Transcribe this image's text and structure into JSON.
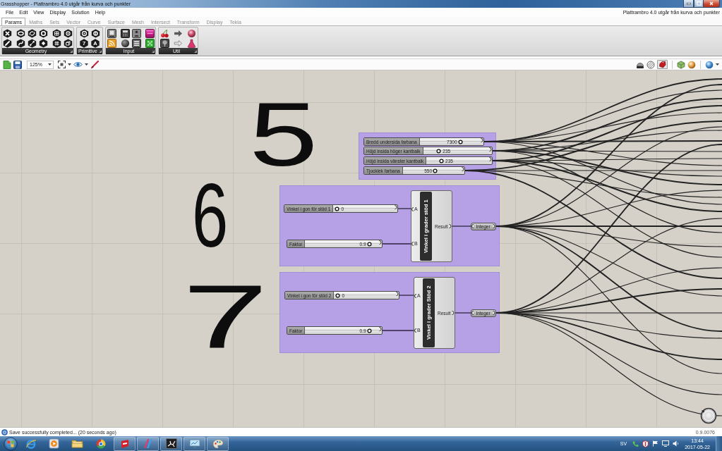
{
  "window": {
    "title": "Grasshopper - Plattrambro 4.0 utgår från kurva och punkter"
  },
  "menu": [
    "File",
    "Edit",
    "View",
    "Display",
    "Solution",
    "Help"
  ],
  "document_title": "Plattrambro 4.0 utgår från kurva och punkter",
  "tabs": [
    {
      "label": "Params",
      "selected": true
    },
    {
      "label": "Maths",
      "selected": false
    },
    {
      "label": "Sets",
      "selected": false
    },
    {
      "label": "Vector",
      "selected": false
    },
    {
      "label": "Curve",
      "selected": false
    },
    {
      "label": "Surface",
      "selected": false
    },
    {
      "label": "Mesh",
      "selected": false
    },
    {
      "label": "Intersect",
      "selected": false
    },
    {
      "label": "Transform",
      "selected": false
    },
    {
      "label": "Display",
      "selected": false
    },
    {
      "label": "Tekla",
      "selected": false
    }
  ],
  "ribbon_groups": [
    {
      "label": "Geometry"
    },
    {
      "label": "Primitive",
      "glyphs": [
        "7",
        "A"
      ]
    },
    {
      "label": "Input"
    },
    {
      "label": "Util"
    }
  ],
  "toolbar": {
    "zoom": "125%"
  },
  "canvas": {
    "annotations": [
      "5",
      "6",
      "7"
    ],
    "groups": [
      {
        "sliders": [
          {
            "label": "Bredd undersida farbana",
            "value": "7300",
            "level": 0.68
          },
          {
            "label": "Höjd insida höger kantbalk",
            "value": "235",
            "level": 0.2
          },
          {
            "label": "Höjd insida vänster kantbalk",
            "value": "235",
            "level": 0.2
          },
          {
            "label": "Tjocklek farbana",
            "value": "550",
            "level": 0.55
          }
        ]
      },
      {
        "sliders": [
          {
            "label": "Vinkel i gon för stöd 1",
            "value": "0",
            "level": 0
          },
          {
            "label": "Faktor",
            "value": "0.9",
            "level": 0.9
          }
        ],
        "component": {
          "name": "Vinkel i grader stöd 1",
          "inputs": [
            "A",
            "B"
          ],
          "output": "Result"
        },
        "output_param": "Integer"
      },
      {
        "sliders": [
          {
            "label": "Vinkel i gon för stöd 2",
            "value": "0",
            "level": 0
          },
          {
            "label": "Faktor",
            "value": "0.9",
            "level": 0.9
          }
        ],
        "component": {
          "name": "Vinkel i grader Stöd 2",
          "inputs": [
            "A",
            "B"
          ],
          "output": "Result"
        },
        "output_param": "Integer"
      }
    ]
  },
  "status_bar": {
    "message": "Save successfully completed... (20 seconds ago)",
    "version": "0.9.0076"
  },
  "taskbar": {
    "language": "SV",
    "time": "13:44",
    "date": "2017-05-22"
  }
}
